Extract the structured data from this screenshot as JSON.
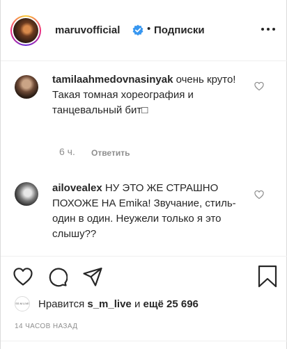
{
  "post": {
    "username": "maruvofficial",
    "separator": "•",
    "follow_status": "Подписки"
  },
  "comments": [
    {
      "username": "tamilaahmedovnasinyak",
      "text": "очень круто! Такая томная хореография и танцевальный бит□",
      "time": "6 ч.",
      "reply_label": "Ответить"
    },
    {
      "username": "ailovealex",
      "text": "НУ ЭТО ЖЕ СТРАШНО ПОХОЖЕ НА Emika! Звучание, стиль-один в один. Неужели только я это слышу??"
    }
  ],
  "likes": {
    "prefix": "Нравится",
    "user": "s_m_live",
    "middle": "и",
    "rest": "ещё 25 696",
    "avatar_text": "SS M LIVE"
  },
  "timestamp": "14 ЧАСОВ НАЗАД",
  "colors": {
    "text": "#262626",
    "muted": "#8e8e8e",
    "verified": "#3897f0",
    "border": "#efefef"
  },
  "icons": [
    "verified-badge-icon",
    "more-options-icon",
    "comment-heart-icon",
    "like-heart-icon",
    "comment-bubble-icon",
    "share-icon",
    "bookmark-icon"
  ]
}
